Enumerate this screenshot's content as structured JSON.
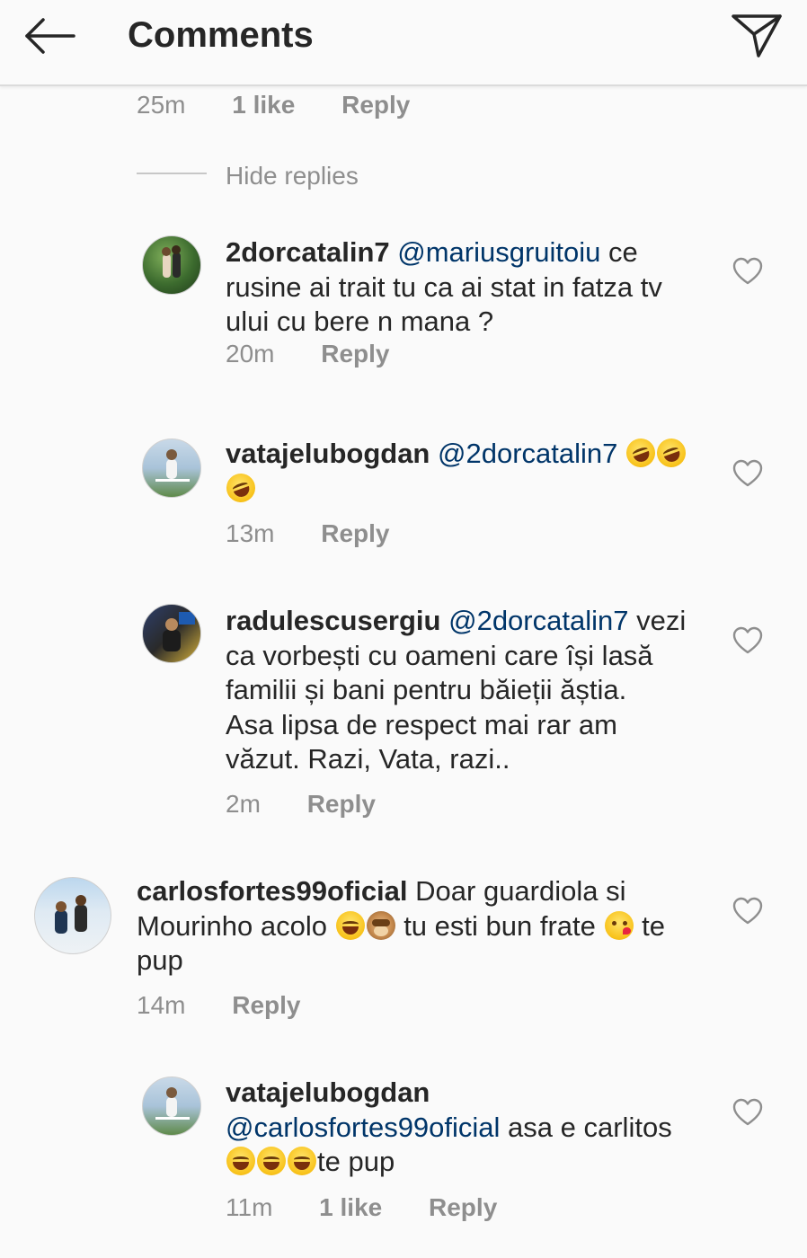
{
  "header": {
    "title": "Comments",
    "back_icon": "arrow-left-icon",
    "send_icon": "paper-plane-icon"
  },
  "top_meta": {
    "time": "25m",
    "likes": "1 like",
    "reply": "Reply"
  },
  "hide_replies": "Hide replies",
  "comments": [
    {
      "username": "2dorcatalin7",
      "mention": "@mariusgruitoiu",
      "lines": [
        " ce",
        "rusine ai trait tu ca ai stat in fatza tv",
        "ului cu bere n mana ?"
      ],
      "time": "20m",
      "reply": "Reply"
    },
    {
      "username": "vatajelubogdan",
      "mention": "@2dorcatalin7",
      "emoji_names": [
        "rolling-on-floor-laughing-icon",
        "rolling-on-floor-laughing-icon",
        "rolling-on-floor-laughing-icon"
      ],
      "time": "13m",
      "reply": "Reply"
    },
    {
      "username": "radulescusergiu",
      "mention": "@2dorcatalin7",
      "lines": [
        " vezi",
        "ca vorbești cu oameni care își lasă",
        "familii și bani pentru băieții ăștia.",
        "Asa lipsa de respect mai rar am",
        "văzut. Razi, Vata, razi.."
      ],
      "time": "2m",
      "reply": "Reply"
    },
    {
      "username": "carlosfortes99oficial",
      "lines": [
        " Doar guardiola si",
        "Mourinho acolo ",
        " tu esti bun frate ",
        " te",
        "pup"
      ],
      "emoji_names": [
        "face-with-tears-of-joy-icon",
        "see-no-evil-monkey-icon",
        "face-blowing-kiss-icon"
      ],
      "time": "14m",
      "reply": "Reply"
    },
    {
      "username": "vatajelubogdan",
      "mention": "@carlosfortes99oficial",
      "lines": [
        " asa e carlitos",
        "te pup"
      ],
      "emoji_names": [
        "face-with-tears-of-joy-icon",
        "face-with-tears-of-joy-icon",
        "face-with-tears-of-joy-icon"
      ],
      "time": "11m",
      "likes": "1 like",
      "reply": "Reply"
    }
  ]
}
